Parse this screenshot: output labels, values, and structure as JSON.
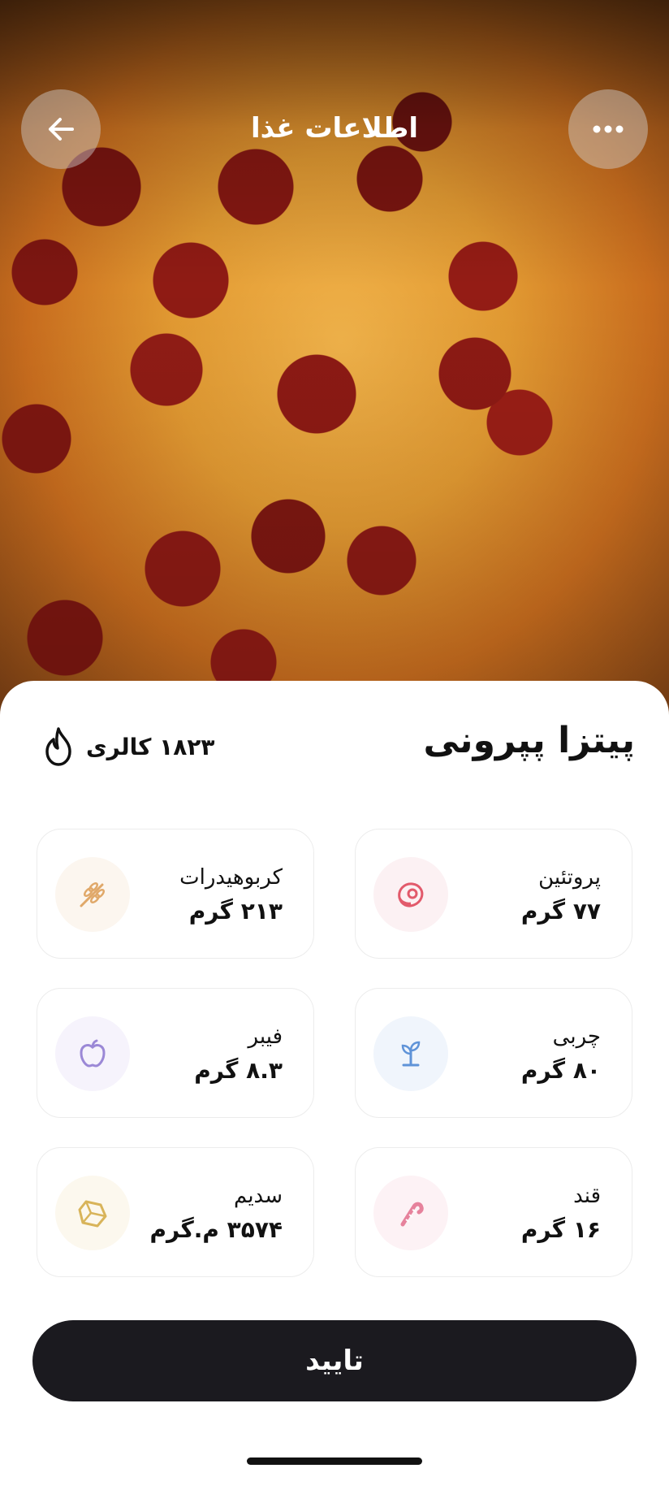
{
  "header": {
    "title": "اطلاعات غذا"
  },
  "food": {
    "name": "پیتزا پپرونی",
    "calories": "۱۸۲۳ کالری"
  },
  "nutrients": [
    {
      "label": "پروتئین",
      "value": "۷۷ گرم",
      "icon": "meat-icon",
      "color": "#e25a6b"
    },
    {
      "label": "کربوهیدرات",
      "value": "۲۱۳ گرم",
      "icon": "wheat-icon",
      "color": "#e0a869"
    },
    {
      "label": "چربی",
      "value": "۸۰ گرم",
      "icon": "sprout-icon",
      "color": "#5f93d8"
    },
    {
      "label": "فیبر",
      "value": "۸.۳ گرم",
      "icon": "apple-icon",
      "color": "#9b88d6"
    },
    {
      "label": "قند",
      "value": "۱۶ گرم",
      "icon": "candy-cane-icon",
      "color": "#e6829c"
    },
    {
      "label": "سدیم",
      "value": "۳۵۷۴ م.گرم",
      "icon": "salt-crystal-icon",
      "color": "#d8b45a"
    }
  ],
  "actions": {
    "confirm_label": "تایید"
  }
}
